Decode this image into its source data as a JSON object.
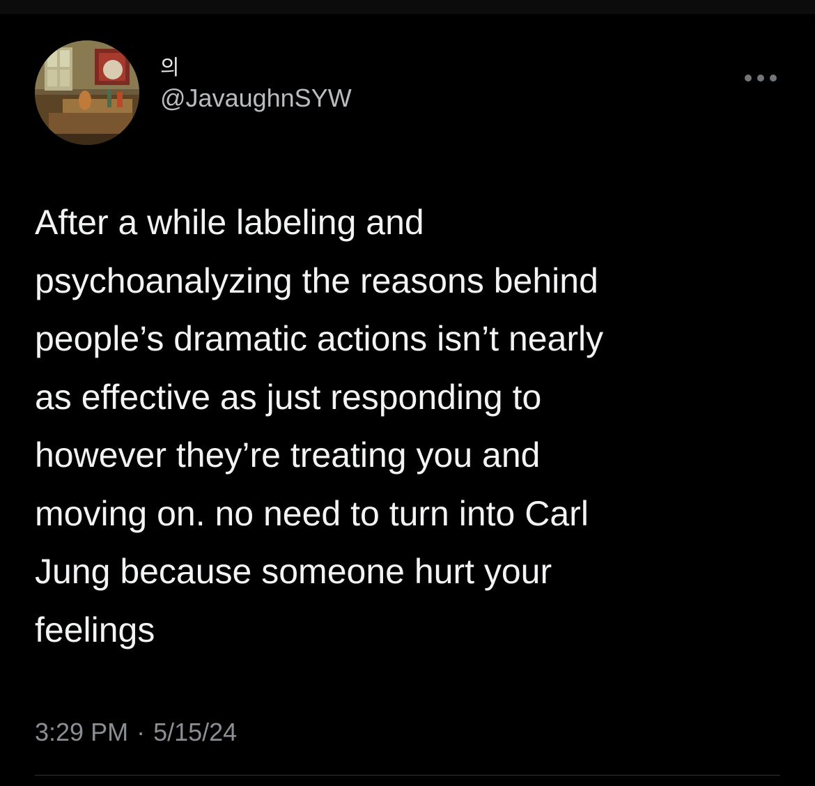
{
  "tweet": {
    "author": {
      "display_name": "의",
      "handle": "@JavaughnSYW",
      "avatar_icon": "avatar-painting-image"
    },
    "more_icon": "more-horizontal-icon",
    "text": "After a while labeling and\npsychoanalyzing the reasons behind\npeople’s dramatic actions isn’t nearly\nas effective as just responding to\nhowever they’re treating you and\nmoving on. no need to turn into Carl\nJung because someone hurt your\nfeelings",
    "time": "3:29 PM",
    "separator": "·",
    "date": "5/15/24"
  },
  "colors": {
    "background": "#000000",
    "text_primary": "#f2f3f4",
    "text_secondary": "#8b8f94",
    "divider": "#2f3336"
  }
}
